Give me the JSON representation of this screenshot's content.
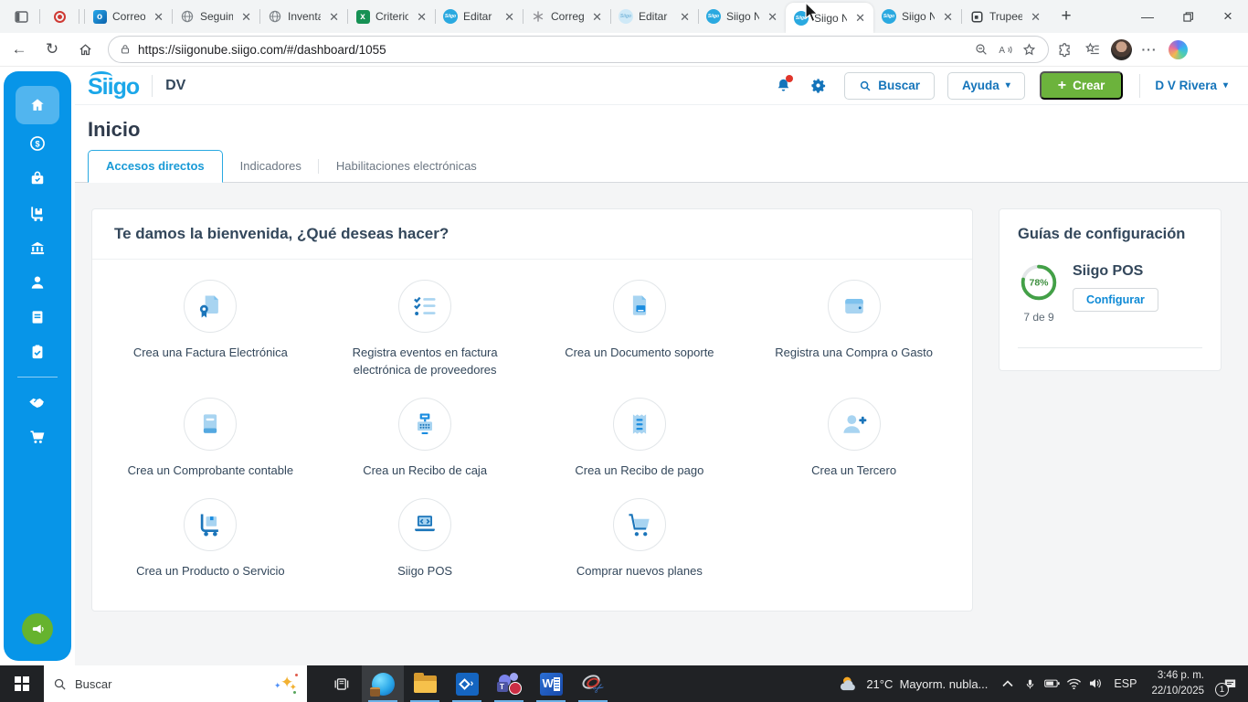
{
  "browser": {
    "tabs": [
      {
        "label": "Correo",
        "icon": "outlook-icon"
      },
      {
        "label": "Seguimi",
        "icon": "globe-icon"
      },
      {
        "label": "Inventa",
        "icon": "globe-icon"
      },
      {
        "label": "Criterio",
        "icon": "excel-icon"
      },
      {
        "label": "Editar",
        "icon": "siigo-icon"
      },
      {
        "label": "Corregi",
        "icon": "chatgpt-icon"
      },
      {
        "label": "Editar",
        "icon": "siigo-light-icon"
      },
      {
        "label": "Siigo N",
        "icon": "siigo-icon"
      },
      {
        "label": "Siigo N",
        "icon": "siigo-icon",
        "active": true
      },
      {
        "label": "Siigo N",
        "icon": "siigo-icon"
      },
      {
        "label": "Trupee",
        "icon": "trupee-icon"
      }
    ],
    "address": {
      "url": "https://siigonube.siigo.com/#/dashboard/1055"
    }
  },
  "app": {
    "brand": {
      "logo_text": "Siigo",
      "company_code": "DV"
    },
    "header": {
      "search_label": "Buscar",
      "help_label": "Ayuda",
      "create_label": "Crear",
      "user_label": "D V Rivera"
    },
    "page_title": "Inicio",
    "tabs": [
      {
        "label": "Accesos directos",
        "active": true
      },
      {
        "label": "Indicadores"
      },
      {
        "label": "Habilitaciones electrónicas"
      }
    ],
    "sidebar_items": [
      "home",
      "sales",
      "purchases",
      "inventory",
      "bank",
      "contacts",
      "ledger",
      "tasks",
      "partners",
      "store",
      "announcements"
    ],
    "welcome": {
      "title": "Te damos la bienvenida, ¿Qué deseas hacer?",
      "shortcuts": [
        {
          "label": "Crea una Factura Electrónica",
          "icon": "invoice-seal-icon"
        },
        {
          "label": "Registra eventos en factura electrónica de proveedores",
          "icon": "checklist-icon"
        },
        {
          "label": "Crea un Documento soporte",
          "icon": "support-doc-icon"
        },
        {
          "label": "Registra una Compra o Gasto",
          "icon": "wallet-icon"
        },
        {
          "label": "Crea un Comprobante contable",
          "icon": "ledger-book-icon"
        },
        {
          "label": "Crea un Recibo de caja",
          "icon": "cash-register-icon"
        },
        {
          "label": "Crea un Recibo de pago",
          "icon": "receipt-icon"
        },
        {
          "label": "Crea un Tercero",
          "icon": "person-plus-icon"
        },
        {
          "label": "Crea un Producto o Servicio",
          "icon": "hand-truck-icon"
        },
        {
          "label": "Siigo POS",
          "icon": "pos-laptop-icon"
        },
        {
          "label": "Comprar nuevos planes",
          "icon": "cart-icon"
        }
      ]
    },
    "guides": {
      "title": "Guías de configuración",
      "items": [
        {
          "name": "Siigo POS",
          "progress_percent": "78%",
          "progress_value": 78,
          "progress_fraction": "7 de 9",
          "action_label": "Configurar"
        }
      ]
    }
  },
  "taskbar": {
    "search_placeholder": "Buscar",
    "apps": [
      "edge",
      "file-explorer",
      "remote-app",
      "teams",
      "word",
      "snipping-tool"
    ],
    "tray": {
      "weather_temp": "21°C",
      "weather_desc": "Mayorm. nubla...",
      "language": "ESP",
      "time": "3:46 p. m.",
      "date": "22/10/2025",
      "notification_count": "1"
    }
  },
  "colors": {
    "sidebar_blue": "#0795e8",
    "accent_blue": "#1474ba",
    "active_tab_blue": "#189ad6",
    "create_green": "#6cb33c",
    "progress_green": "#43a047",
    "navy_text": "#33475b"
  }
}
